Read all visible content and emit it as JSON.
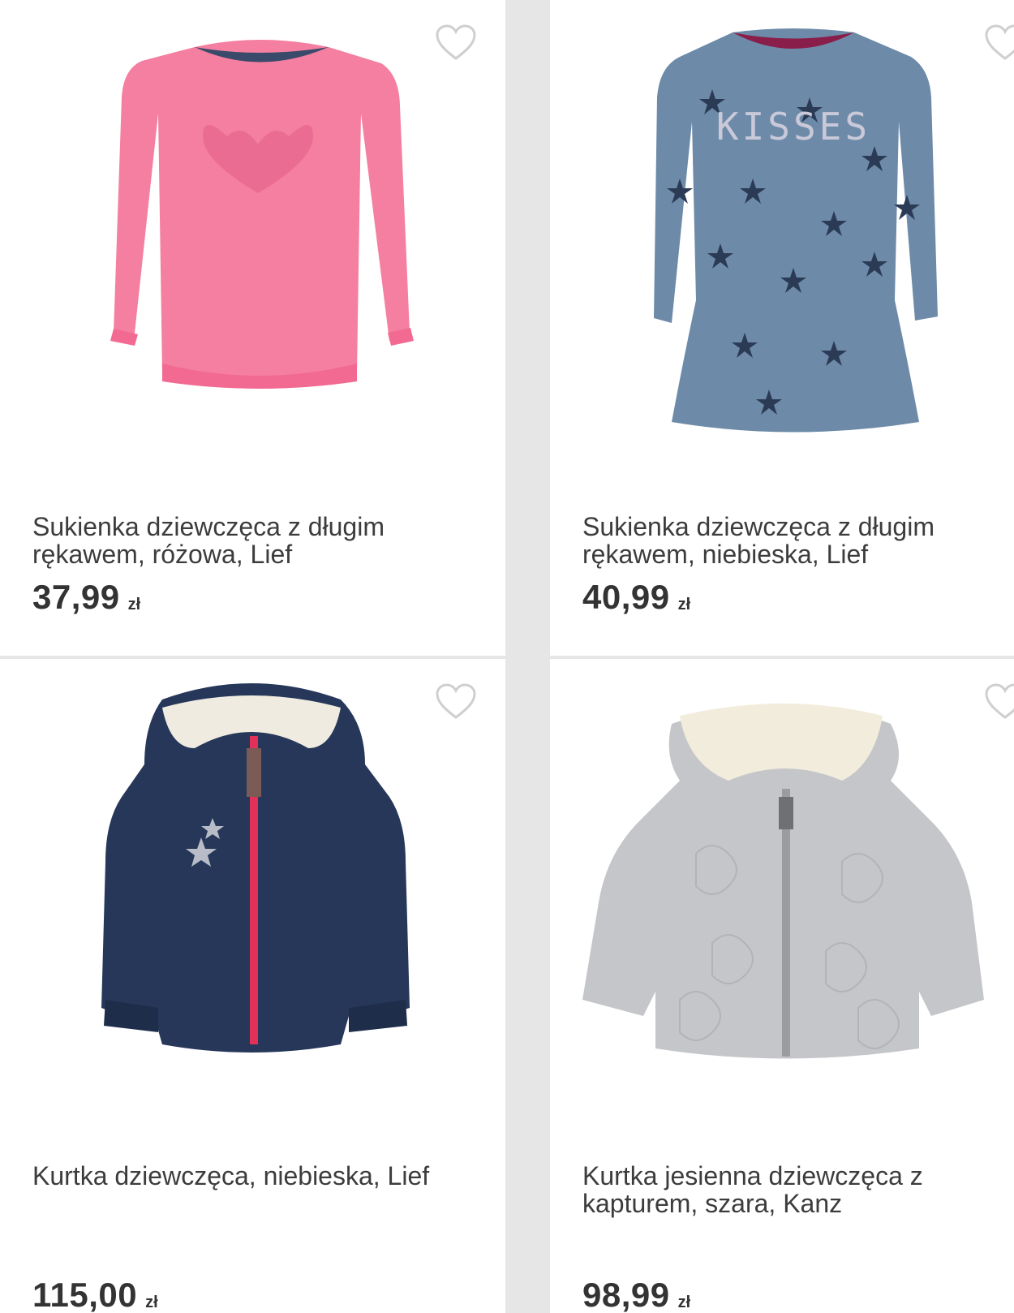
{
  "products": [
    {
      "title": "Sukienka dziewczęca z długim rękawem, różowa, Lief",
      "price": "37,99",
      "currency": "zł",
      "favorite_icon": "heart-outline-icon",
      "image": "pink-long-sleeve-dress"
    },
    {
      "title": "Sukienka dziewczęca z długim rękawem, niebieska, Lief",
      "price": "40,99",
      "currency": "zł",
      "favorite_icon": "heart-outline-icon",
      "image": "blue-star-dress"
    },
    {
      "title": "Kurtka dziewczęca, niebieska, Lief",
      "price": "115,00",
      "currency": "zł",
      "favorite_icon": "heart-outline-icon",
      "image": "navy-puffer-jacket"
    },
    {
      "title": "Kurtka jesienna dziewczęca z kapturem, szara, Kanz",
      "price": "98,99",
      "currency": "zł",
      "favorite_icon": "heart-outline-icon",
      "image": "grey-hooded-jacket"
    }
  ],
  "colors": {
    "background": "#e6e6e6",
    "card": "#ffffff",
    "text": "#3c3c3c",
    "heart_outline": "#cfcfcf"
  }
}
